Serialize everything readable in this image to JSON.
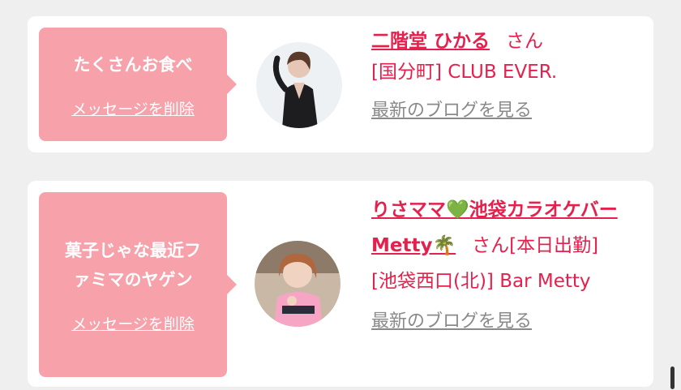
{
  "messages": [
    {
      "text": "たくさんお食べ",
      "delete_label": "メッセージを削除",
      "name": "二階堂 ひかる",
      "honorific": "さん",
      "store": "[国分町] CLUB EVER.",
      "blog_label": "最新のブログを見る"
    },
    {
      "text": "菓子じゃな最近フ\nァミマのヤゲン",
      "delete_label": "メッセージを削除",
      "name": "りさママ💚池袋カラオケバーMetty🌴",
      "honorific": "さん[本日出勤]",
      "store": "[池袋西口(北)] Bar Metty",
      "blog_label": "最新のブログを見る"
    }
  ],
  "colors": {
    "accent": "#e4214c",
    "bubble": "#f7a1aa",
    "link_gray": "#8a8a8a",
    "background": "#efefef"
  }
}
